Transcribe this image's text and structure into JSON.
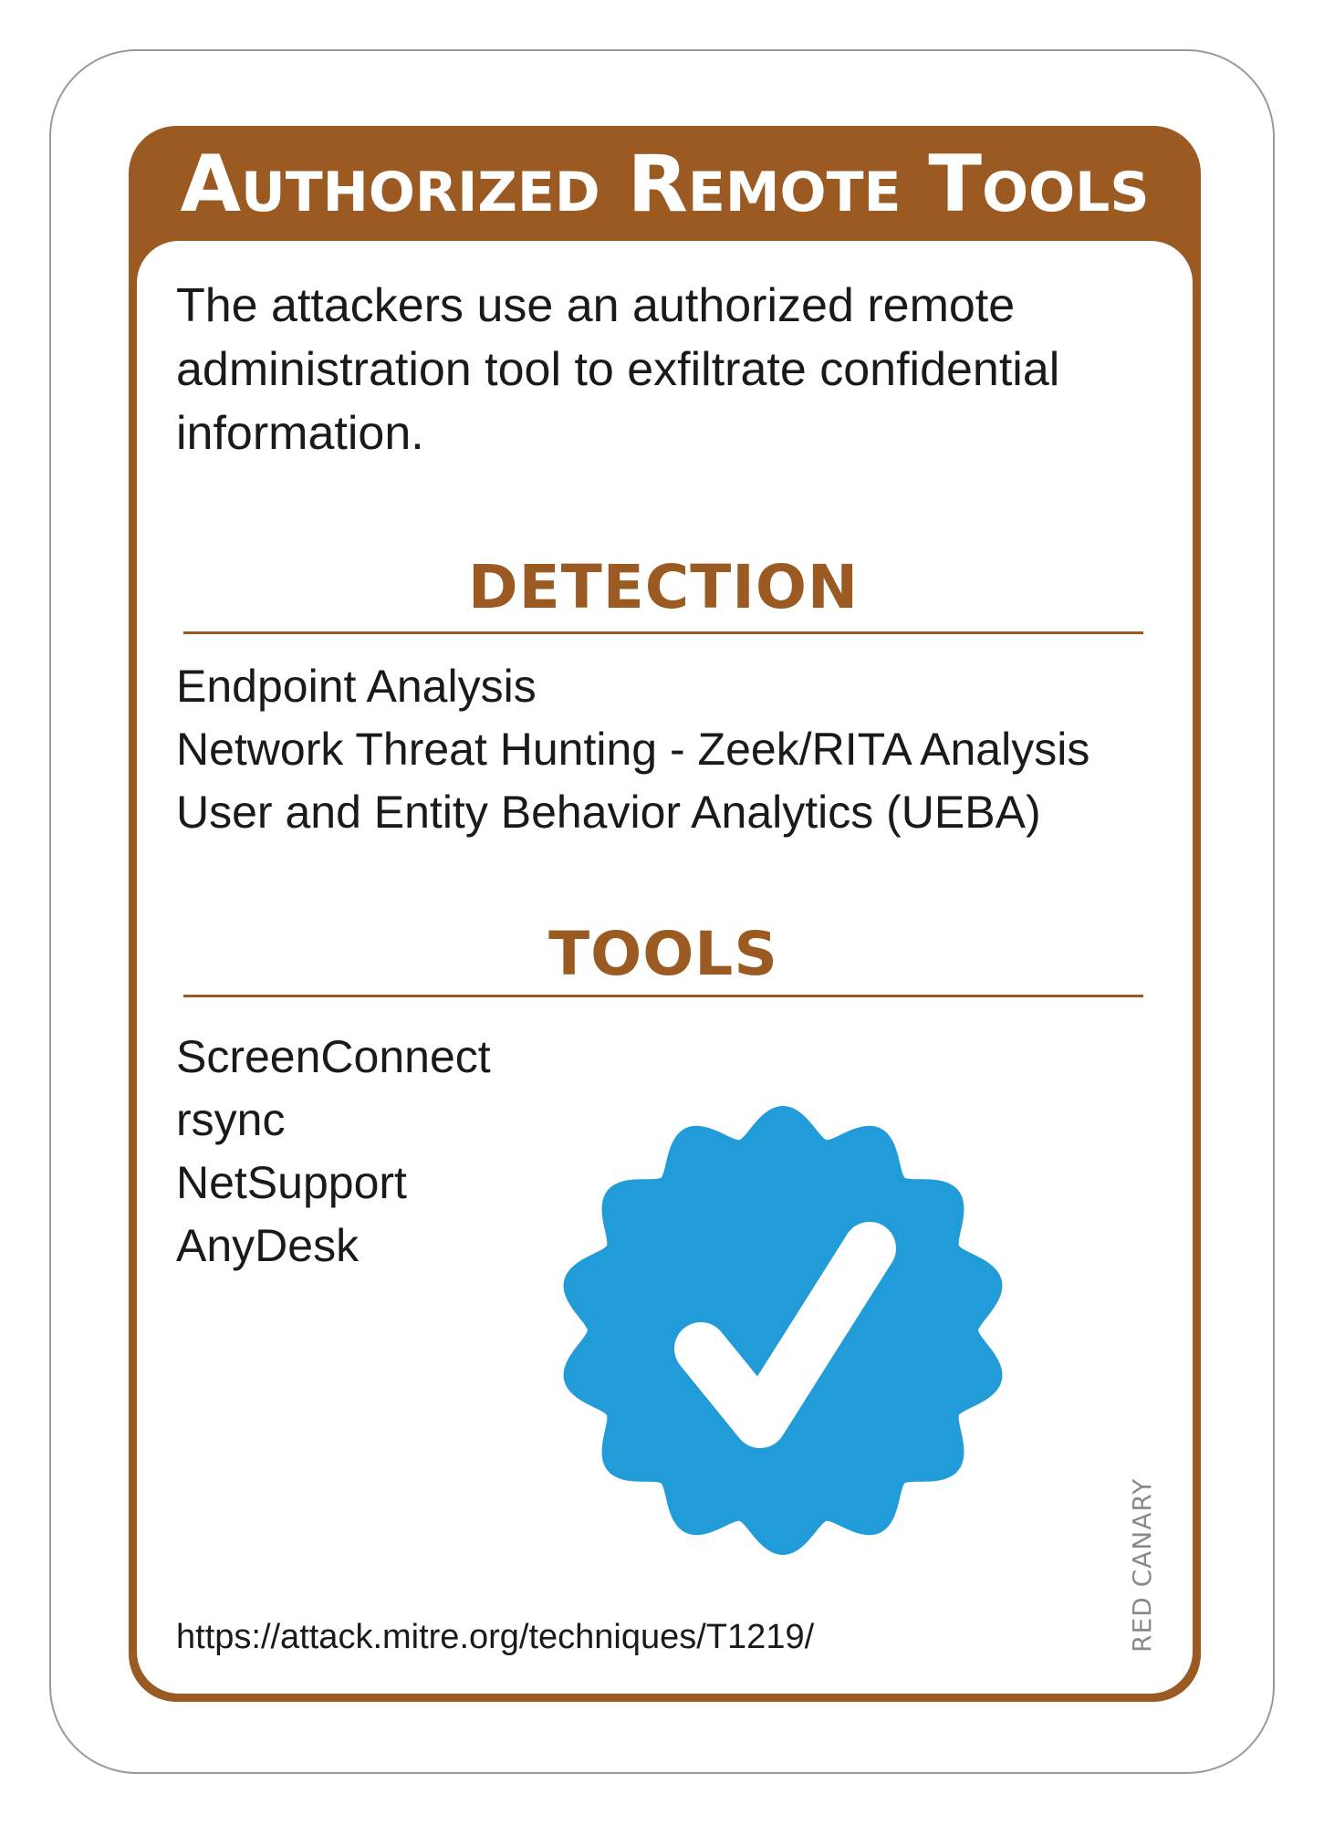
{
  "card": {
    "title": "Authorized Remote Tools",
    "description": "The attackers use an authorized remote administration tool to exfiltrate confidential information.",
    "colors": {
      "frame": "#9a5a22",
      "badge": "#229cd8",
      "border": "#9a9a9a"
    }
  },
  "detection": {
    "heading": "DETECTION",
    "items": [
      "Endpoint Analysis",
      "Network Threat Hunting - Zeek/RITA Analysis",
      "User and Entity Behavior Analytics (UEBA)"
    ]
  },
  "tools": {
    "heading": "TOOLS",
    "items": [
      "ScreenConnect",
      "rsync",
      "NetSupport",
      "AnyDesk"
    ]
  },
  "badge": {
    "icon": "verified-check-badge-icon"
  },
  "footer": {
    "url": "https://attack.mitre.org/techniques/T1219/",
    "brand": "RED CANARY"
  }
}
